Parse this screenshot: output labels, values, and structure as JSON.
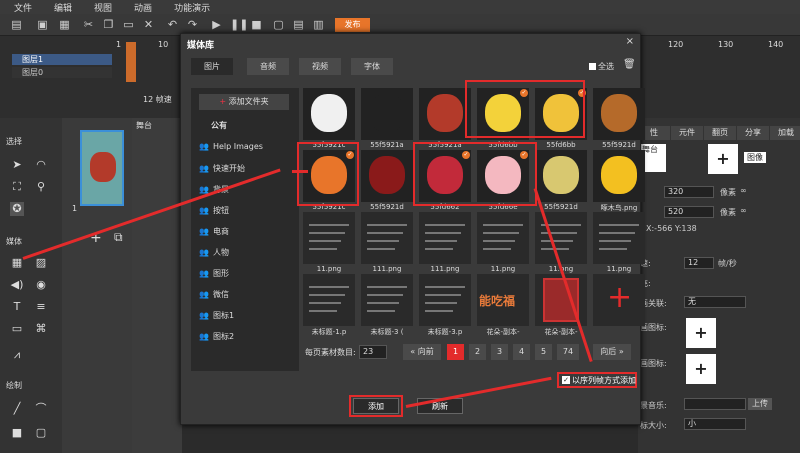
{
  "menu": {
    "file": "文件",
    "edit": "编辑",
    "view": "视图",
    "anim": "动画",
    "demo": "功能演示"
  },
  "toolbar": {
    "publish": "发布"
  },
  "timeline": {
    "layer1": "图层1",
    "layer0": "图层0",
    "track_count": "12 帧速",
    "ticks": [
      "1",
      "10",
      "120",
      "130",
      "140"
    ]
  },
  "left": {
    "select": "选择",
    "media": "媒体",
    "draw": "绘制",
    "scene_no": "1"
  },
  "stage": {
    "label": "舞台"
  },
  "right": {
    "tabs": [
      "性",
      "元件",
      "翻页",
      "分享",
      "加载"
    ],
    "stage_label": "舞台",
    "image_btn": "图像",
    "w": "320",
    "h": "520",
    "unit": "像素",
    "xy": "X:-566  Y:138",
    "fps_label": "速:",
    "fps": "12",
    "fps_unit": "帧/秒",
    "b1": "充:",
    "b2": "画关联:",
    "none": "无",
    "b3": "画图标:",
    "b4": "画图标:",
    "music": "景音乐:",
    "upload": "上传",
    "size": "标大小:",
    "small": "小"
  },
  "modal": {
    "title": "媒体库",
    "close": "×",
    "select_all": "全选",
    "tabs": [
      "图片",
      "音频",
      "视频",
      "字体"
    ],
    "add_folder": "添加文件夹",
    "public": "公有",
    "folders": [
      "Help Images",
      "快速开始",
      "背景",
      "按钮",
      "电商",
      "人物",
      "图形",
      "微信",
      "图标1",
      "图标2"
    ],
    "items": [
      {
        "label": "55f5921c",
        "checked": false
      },
      {
        "label": "55f5921a",
        "checked": false
      },
      {
        "label": "55f5921a",
        "checked": false
      },
      {
        "label": "55fd6bb",
        "checked": true
      },
      {
        "label": "55fd6bb",
        "checked": true
      },
      {
        "label": "55f5921d",
        "checked": false
      },
      {
        "label": "55f5921c",
        "checked": true
      },
      {
        "label": "55f5921d",
        "checked": false
      },
      {
        "label": "55fd662",
        "checked": true
      },
      {
        "label": "55fd66e",
        "checked": true
      },
      {
        "label": "55f5921d",
        "checked": false
      },
      {
        "label": "啄木鸟.png",
        "checked": false
      },
      {
        "label": "11.png",
        "checked": false
      },
      {
        "label": "111.png",
        "checked": false
      },
      {
        "label": "111.png",
        "checked": false
      },
      {
        "label": "11.png",
        "checked": false
      },
      {
        "label": "11.png",
        "checked": false
      },
      {
        "label": "11.png",
        "checked": false
      },
      {
        "label": "未标题-1.p",
        "checked": false
      },
      {
        "label": "未标题-3 (",
        "checked": false
      },
      {
        "label": "未标题-3.p",
        "checked": false
      },
      {
        "label": "花朵-副本-",
        "checked": false
      },
      {
        "label": "花朵-副本-",
        "checked": false
      },
      {
        "label": "",
        "checked": false
      }
    ],
    "text_thumb": "能吃福",
    "per_page_label": "每页素材数目:",
    "per_page": "23",
    "prev": "« 向前",
    "next": "向后 »",
    "pages": [
      "1",
      "2",
      "3",
      "4",
      "5",
      "74"
    ],
    "seq_label": "以序列帧方式添加",
    "add": "添加",
    "refresh": "刷新"
  }
}
